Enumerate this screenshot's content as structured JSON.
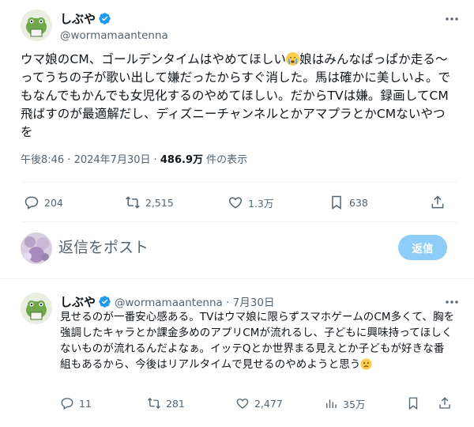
{
  "main_tweet": {
    "display_name": "しぶや",
    "handle": "@wormamaantenna",
    "text_part1": "ウマ娘のCM、ゴールデンタイムはやめてほしい",
    "text_part2": "娘はみんなぱっぱか走る〜ってうちの子が歌い出して嫌だったからすぐ消した。馬は確かに美しいよ。でもなんでもかんでも女児化するのやめてほしい。だからTVは嫌。録画してCM飛ばすのが最適解だし、ディズニーチャンネルとかアマプラとかCMないやつを",
    "timestamp": "午後8:46 · 2024年7月30日 · ",
    "views_count": "486.9万",
    "views_label": " 件の表示",
    "actions": {
      "replies": "204",
      "reposts": "2,515",
      "likes": "1.3万",
      "bookmarks": "638"
    }
  },
  "reply_composer": {
    "placeholder": "返信をポスト",
    "button_label": "返信"
  },
  "reply_tweet": {
    "display_name": "しぶや",
    "handle": "@wormamaantenna",
    "separator": " · ",
    "date": "7月30日",
    "text": "見せるのが一番安心感ある。TVはウマ娘に限らずスマホゲームのCM多くて、胸を強調したキャラとか課金多めのアプリCMが流れるし、子どもに興味持ってほしくないものが流れるんだよなぁ。イッテQとか世界まる見えとか子どもが好きな番組もあるから、今後はリアルタイムで見せるのやめようと思う",
    "actions": {
      "replies": "11",
      "reposts": "281",
      "likes": "2,477",
      "views": "35万"
    }
  },
  "colors": {
    "verified": "#1d9bf0",
    "reply_button": "#8ecdf8",
    "secondary_text": "#536471"
  },
  "icons": [
    "more-icon",
    "verified-icon",
    "reply-icon",
    "repost-icon",
    "like-icon",
    "bookmark-icon",
    "share-icon",
    "views-icon",
    "crying-emoji-icon",
    "worried-emoji-icon"
  ]
}
